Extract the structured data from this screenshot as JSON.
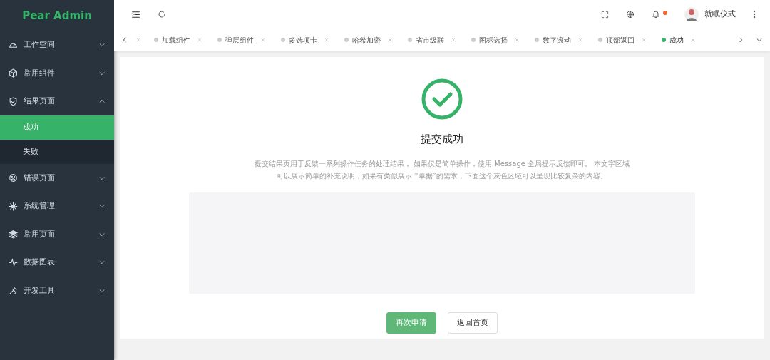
{
  "sidebar": {
    "logo": "Pear Admin",
    "items": [
      {
        "label": "工作空间",
        "kind": "gauge",
        "expanded": false
      },
      {
        "label": "常用组件",
        "kind": "cube",
        "expanded": false
      },
      {
        "label": "结果页面",
        "kind": "shield",
        "expanded": true,
        "children": [
          {
            "label": "成功",
            "selected": true
          },
          {
            "label": "失败",
            "selected": false
          }
        ]
      },
      {
        "label": "错误页面",
        "kind": "face",
        "expanded": false
      },
      {
        "label": "系统管理",
        "kind": "gear",
        "expanded": false
      },
      {
        "label": "常用页面",
        "kind": "layers",
        "expanded": false
      },
      {
        "label": "数据图表",
        "kind": "pulse",
        "expanded": false
      },
      {
        "label": "开发工具",
        "kind": "tools",
        "expanded": false
      }
    ]
  },
  "header": {
    "user": "就眠仪式",
    "notification": {
      "unread": true
    }
  },
  "tabs": [
    {
      "kind": "cut"
    },
    {
      "label": "加载组件",
      "selected": false
    },
    {
      "label": "弹层组件",
      "selected": false
    },
    {
      "label": "多选项卡",
      "selected": false
    },
    {
      "label": "哈希加密",
      "selected": false
    },
    {
      "label": "省市级联",
      "selected": false
    },
    {
      "label": "图标选择",
      "selected": false
    },
    {
      "label": "数字滚动",
      "selected": false
    },
    {
      "label": "顶部返回",
      "selected": false
    },
    {
      "label": "成功",
      "selected": true
    }
  ],
  "result": {
    "kind": "success",
    "title": "提交成功",
    "description": "提交结果页用于反馈一系列操作任务的处理结果， 如果仅是简单操作，使用 Message 全局提示反馈即可。 本文字区域可以展示简单的补充说明，如果有类似展示 “单据”的需求，下面这个灰色区域可以呈现比较复杂的内容。",
    "buttons": [
      {
        "label": "再次申请",
        "kind": "primary"
      },
      {
        "label": "返回首页",
        "kind": "default"
      }
    ]
  }
}
